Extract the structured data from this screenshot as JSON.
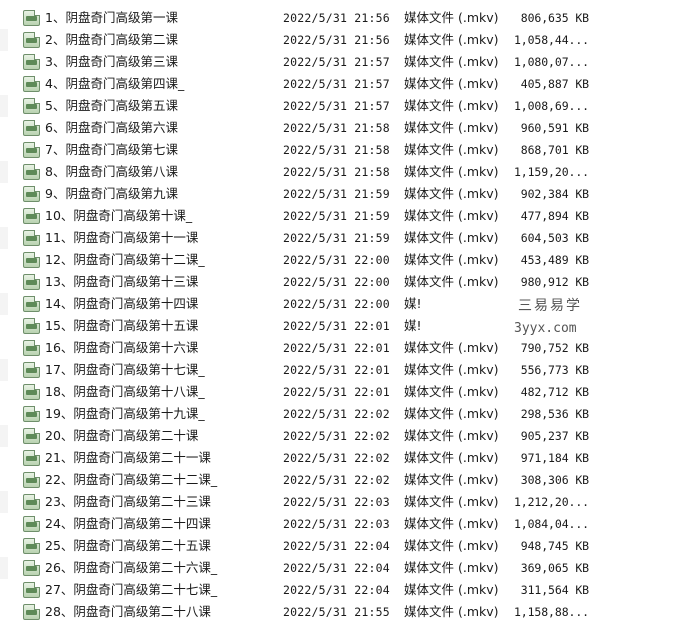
{
  "files": [
    {
      "name": "1、阴盘奇门高级第一课",
      "modified": "2022/5/31 21:56",
      "type": "媒体文件 (.mkv)",
      "size": "806,635 KB"
    },
    {
      "name": "2、阴盘奇门高级第二课",
      "modified": "2022/5/31 21:56",
      "type": "媒体文件 (.mkv)",
      "size": "1,058,44..."
    },
    {
      "name": "3、阴盘奇门高级第三课",
      "modified": "2022/5/31 21:57",
      "type": "媒体文件 (.mkv)",
      "size": "1,080,07..."
    },
    {
      "name": "4、阴盘奇门高级第四课_",
      "modified": "2022/5/31 21:57",
      "type": "媒体文件 (.mkv)",
      "size": "405,887 KB"
    },
    {
      "name": "5、阴盘奇门高级第五课",
      "modified": "2022/5/31 21:57",
      "type": "媒体文件 (.mkv)",
      "size": "1,008,69..."
    },
    {
      "name": "6、阴盘奇门高级第六课",
      "modified": "2022/5/31 21:58",
      "type": "媒体文件 (.mkv)",
      "size": "960,591 KB"
    },
    {
      "name": "7、阴盘奇门高级第七课",
      "modified": "2022/5/31 21:58",
      "type": "媒体文件 (.mkv)",
      "size": "868,701 KB"
    },
    {
      "name": "8、阴盘奇门高级第八课",
      "modified": "2022/5/31 21:58",
      "type": "媒体文件 (.mkv)",
      "size": "1,159,20..."
    },
    {
      "name": "9、阴盘奇门高级第九课",
      "modified": "2022/5/31 21:59",
      "type": "媒体文件 (.mkv)",
      "size": "902,384 KB"
    },
    {
      "name": "10、阴盘奇门高级第十课_",
      "modified": "2022/5/31 21:59",
      "type": "媒体文件 (.mkv)",
      "size": "477,894 KB"
    },
    {
      "name": "11、阴盘奇门高级第十一课",
      "modified": "2022/5/31 21:59",
      "type": "媒体文件 (.mkv)",
      "size": "604,503 KB"
    },
    {
      "name": "12、阴盘奇门高级第十二课_",
      "modified": "2022/5/31 22:00",
      "type": "媒体文件 (.mkv)",
      "size": "453,489 KB"
    },
    {
      "name": "13、阴盘奇门高级第十三课",
      "modified": "2022/5/31 22:00",
      "type": "媒体文件 (.mkv)",
      "size": "980,912 KB"
    },
    {
      "name": "14、阴盘奇门高级第十四课",
      "modified": "2022/5/31 22:00",
      "type": "媒!",
      "size": ""
    },
    {
      "name": "15、阴盘奇门高级第十五课",
      "modified": "2022/5/31 22:01",
      "type": "媒!",
      "size": ""
    },
    {
      "name": "16、阴盘奇门高级第十六课",
      "modified": "2022/5/31 22:01",
      "type": "媒体文件 (.mkv)",
      "size": "790,752 KB"
    },
    {
      "name": "17、阴盘奇门高级第十七课_",
      "modified": "2022/5/31 22:01",
      "type": "媒体文件 (.mkv)",
      "size": "556,773 KB"
    },
    {
      "name": "18、阴盘奇门高级第十八课_",
      "modified": "2022/5/31 22:01",
      "type": "媒体文件 (.mkv)",
      "size": "482,712 KB"
    },
    {
      "name": "19、阴盘奇门高级第十九课_",
      "modified": "2022/5/31 22:02",
      "type": "媒体文件 (.mkv)",
      "size": "298,536 KB"
    },
    {
      "name": "20、阴盘奇门高级第二十课",
      "modified": "2022/5/31 22:02",
      "type": "媒体文件 (.mkv)",
      "size": "905,237 KB"
    },
    {
      "name": "21、阴盘奇门高级第二十一课",
      "modified": "2022/5/31 22:02",
      "type": "媒体文件 (.mkv)",
      "size": "971,184 KB"
    },
    {
      "name": "22、阴盘奇门高级第二十二课_",
      "modified": "2022/5/31 22:02",
      "type": "媒体文件 (.mkv)",
      "size": "308,306 KB"
    },
    {
      "name": "23、阴盘奇门高级第二十三课",
      "modified": "2022/5/31 22:03",
      "type": "媒体文件 (.mkv)",
      "size": "1,212,20..."
    },
    {
      "name": "24、阴盘奇门高级第二十四课",
      "modified": "2022/5/31 22:03",
      "type": "媒体文件 (.mkv)",
      "size": "1,084,04..."
    },
    {
      "name": "25、阴盘奇门高级第二十五课",
      "modified": "2022/5/31 22:04",
      "type": "媒体文件 (.mkv)",
      "size": "948,745 KB"
    },
    {
      "name": "26、阴盘奇门高级第二十六课_",
      "modified": "2022/5/31 22:04",
      "type": "媒体文件 (.mkv)",
      "size": "369,065 KB"
    },
    {
      "name": "27、阴盘奇门高级第二十七课_",
      "modified": "2022/5/31 22:04",
      "type": "媒体文件 (.mkv)",
      "size": "311,564 KB"
    },
    {
      "name": "28、阴盘奇门高级第二十八课",
      "modified": "2022/5/31 21:55",
      "type": "媒体文件 (.mkv)",
      "size": "1,158,88..."
    }
  ],
  "file_icon": "mkv-video-file-icon",
  "watermark": {
    "name": "三易易学",
    "url": "3yyx.com"
  }
}
